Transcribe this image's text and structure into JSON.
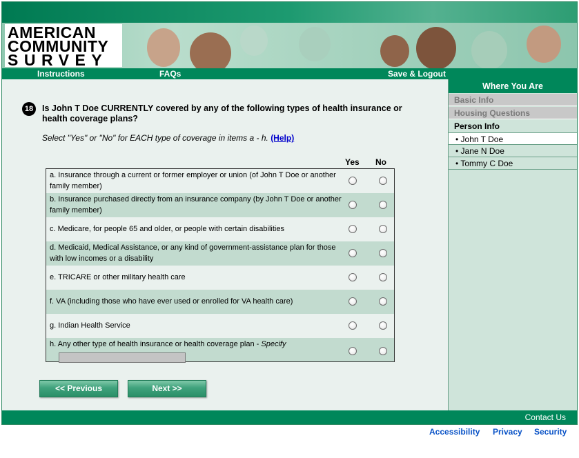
{
  "logo": {
    "line1": "AMERICAN",
    "line2": "COMMUNITY",
    "line3": "SURVEY"
  },
  "nav": {
    "instructions": "Instructions",
    "faqs": "FAQs",
    "save_logout": "Save & Logout"
  },
  "question": {
    "number": "18",
    "text": "Is John T Doe CURRENTLY covered by any of the following types of health insurance or health coverage plans?",
    "instruction": "Select \"Yes\" or \"No\" for EACH type of coverage in items a - h.",
    "help_label": "(Help)",
    "col_yes": "Yes",
    "col_no": "No",
    "items": [
      {
        "label": "a. Insurance through a current or former employer or union (of John T Doe or another family member)"
      },
      {
        "label": "b. Insurance purchased directly from an insurance company (by John T Doe or another family member)"
      },
      {
        "label": "c. Medicare, for people 65 and older, or people with certain disabilities"
      },
      {
        "label": "d. Medicaid, Medical Assistance, or any kind of government-assistance plan for those with low incomes or a disability"
      },
      {
        "label": "e. TRICARE or other military health care"
      },
      {
        "label": "f. VA (including those who have ever used or enrolled for VA health care)"
      },
      {
        "label": "g. Indian Health Service"
      },
      {
        "label": "h. Any other type of health insurance or health coverage plan - ",
        "specify": "Specify",
        "specify_value": ""
      }
    ]
  },
  "buttons": {
    "previous": "<<   Previous",
    "next": "Next   >>"
  },
  "sidebar": {
    "title": "Where You Are",
    "basic_info": "Basic Info",
    "housing": "Housing Questions",
    "person_info": "Person Info",
    "persons": [
      "• John T Doe",
      "• Jane N Doe",
      "• Tommy C Doe"
    ]
  },
  "footer": {
    "contact": "Contact Us",
    "accessibility": "Accessibility",
    "privacy": "Privacy",
    "security": "Security"
  },
  "colors": {
    "brand_green": "#00875a",
    "row_shade": "#c2dbcf",
    "background": "#eaf1ee",
    "link_blue": "#0a53c7"
  }
}
